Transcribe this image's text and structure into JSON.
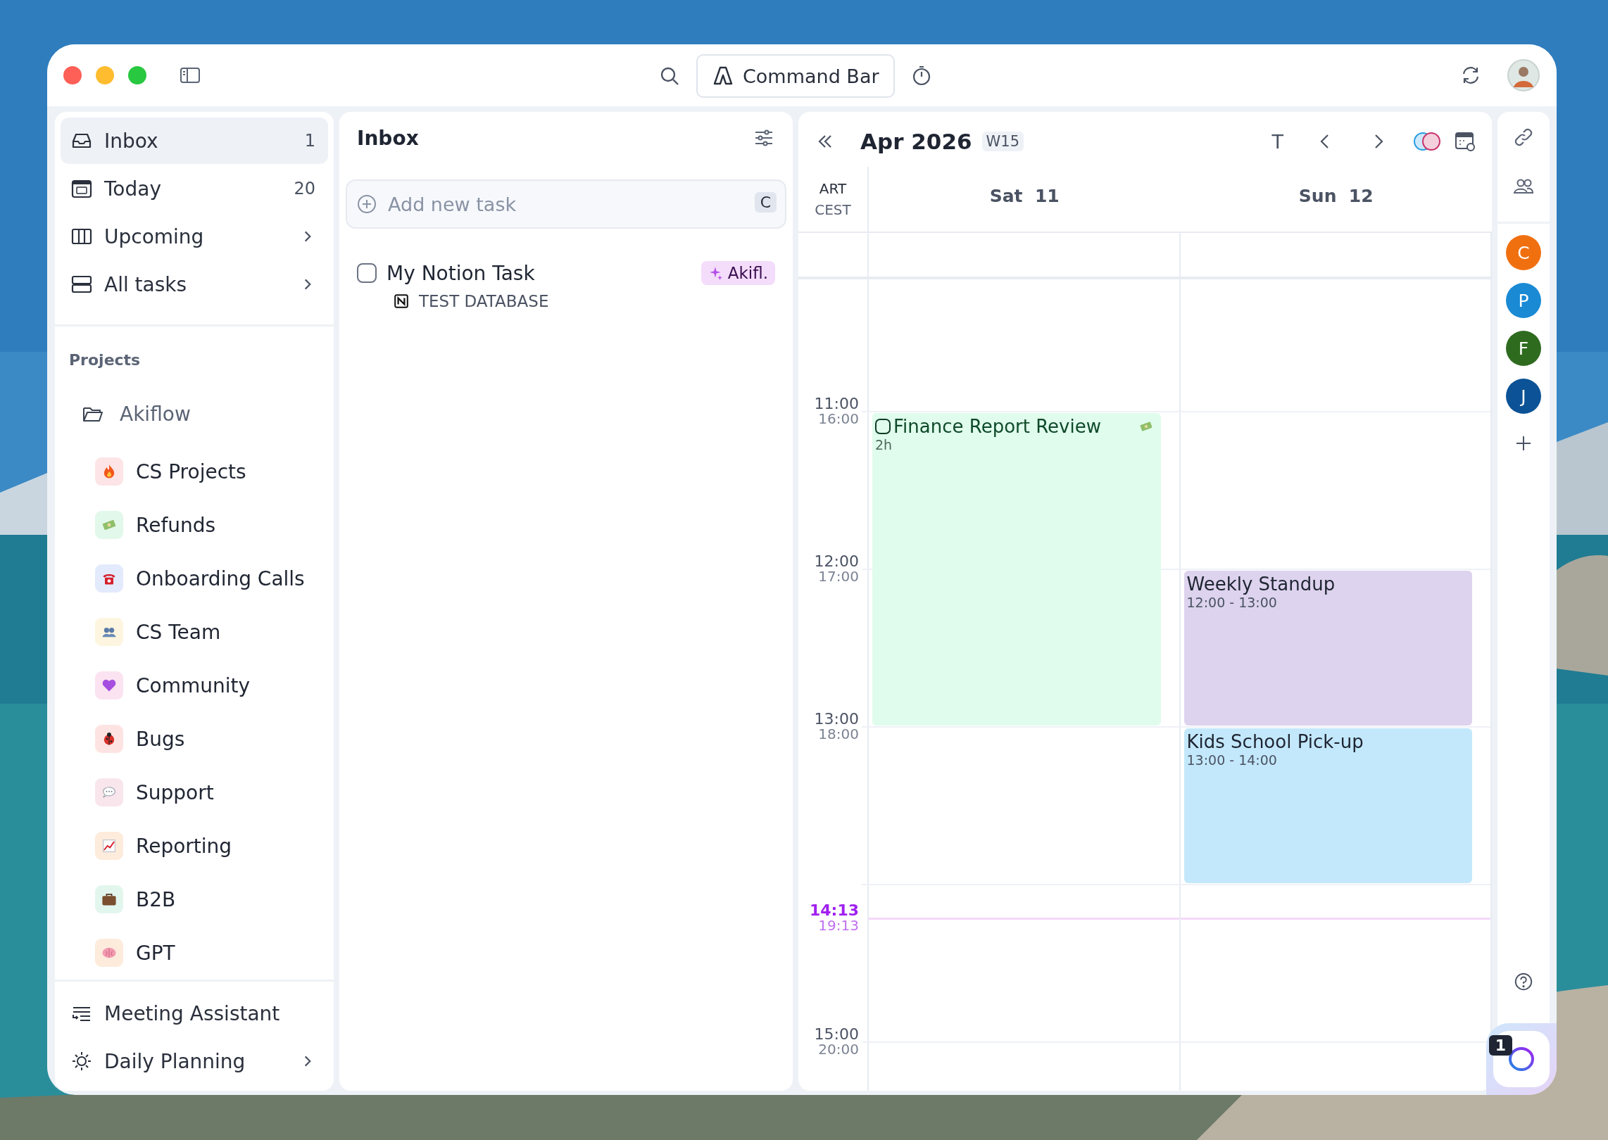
{
  "toolbar": {
    "command_bar": "Command Bar"
  },
  "sidebar": {
    "items": [
      {
        "label": "Inbox",
        "count": "1",
        "selected": true
      },
      {
        "label": "Today",
        "count": "20",
        "selected": false
      },
      {
        "label": "Upcoming",
        "chevron": true,
        "selected": false
      },
      {
        "label": "All tasks",
        "chevron": true,
        "selected": false
      }
    ],
    "projects_heading": "Projects",
    "folder": {
      "label": "Akiflow",
      "children": [
        {
          "label": "CS Projects",
          "color": "#fde4e6"
        },
        {
          "label": "Refunds",
          "color": "#e2f8ea"
        },
        {
          "label": "Onboarding Calls",
          "color": "#e3eafc"
        },
        {
          "label": "CS Team",
          "color": "#fdf5df"
        },
        {
          "label": "Community",
          "color": "#fbe3f1"
        },
        {
          "label": "Bugs",
          "color": "#fde4e2"
        },
        {
          "label": "Support",
          "color": "#f9e5ec"
        },
        {
          "label": "Reporting",
          "color": "#fdebdc"
        },
        {
          "label": "B2B",
          "color": "#e3f6ee"
        },
        {
          "label": "GPT",
          "color": "#fdebdc"
        }
      ]
    },
    "footer_items": [
      {
        "label": "Meeting Assistant"
      },
      {
        "label": "Daily Planning",
        "chevron": true
      }
    ]
  },
  "inbox": {
    "title": "Inbox",
    "add_task": {
      "placeholder": "Add new task",
      "shortcut": "C"
    },
    "tasks": [
      {
        "title": "My Notion Task",
        "checked": false,
        "tag": "Akifl.",
        "source": "TEST DATABASE"
      }
    ]
  },
  "calendar": {
    "month": "Apr 2026",
    "week": "W15",
    "today_button": "T",
    "timezones": [
      "ART",
      "CEST"
    ],
    "days": [
      {
        "label": "Sat  11",
        "events": [
          {
            "title": "Finance Report Review",
            "detail": "2h",
            "kind": "task",
            "color": "#e0fcec"
          }
        ]
      },
      {
        "label": "Sun  12",
        "events": [
          {
            "title": "Weekly Standup",
            "detail": "12:00 - 13:00",
            "kind": "event",
            "color": "#ddd3ee"
          },
          {
            "title": "Kids School Pick-up",
            "detail": "13:00 - 14:00",
            "kind": "event",
            "color": "#c3e8fb"
          }
        ]
      }
    ],
    "hours": [
      {
        "primary": "11:00",
        "secondary": "16:00",
        "kind": "hour"
      },
      {
        "primary": "12:00",
        "secondary": "17:00",
        "kind": "hour"
      },
      {
        "primary": "13:00",
        "secondary": "18:00",
        "kind": "hour"
      },
      {
        "primary": "14:13",
        "secondary": "19:13",
        "kind": "now"
      },
      {
        "primary": "15:00",
        "secondary": "20:00",
        "kind": "hour"
      }
    ]
  },
  "rail": {
    "avatars": [
      {
        "letter": "C",
        "color": "#f07010"
      },
      {
        "letter": "P",
        "color": "#1a8ad4"
      },
      {
        "letter": "F",
        "color": "#2f6b1f"
      },
      {
        "letter": "J",
        "color": "#0c5296"
      }
    ],
    "assistant_badge": "1"
  }
}
